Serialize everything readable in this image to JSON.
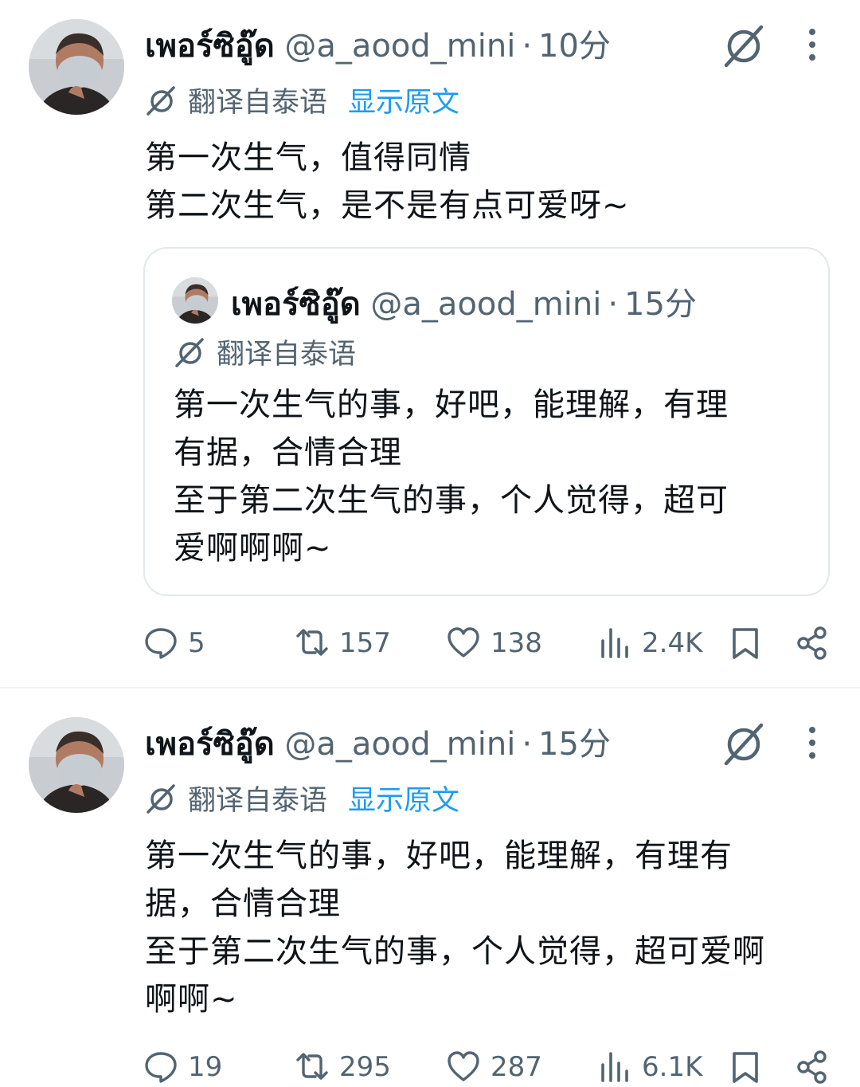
{
  "tweets": [
    {
      "display_name": "เพอร์ซิอู๊ด",
      "handle": "@a_aood_mini",
      "separator": "·",
      "time": "10分",
      "translated_label": "翻译自泰语",
      "show_original": "显示原文",
      "text": "第一次生气，值得同情\n第二次生气，是不是有点可爱呀~",
      "quote": {
        "display_name": "เพอร์ซิอู๊ด",
        "handle": "@a_aood_mini",
        "separator": "·",
        "time": "15分",
        "translated_label": "翻译自泰语",
        "text": "第一次生气的事，好吧，能理解，有理\n有据，合情合理\n至于第二次生气的事，个人觉得，超可\n爱啊啊啊~"
      },
      "actions": {
        "replies": "5",
        "reposts": "157",
        "likes": "138",
        "views": "2.4K"
      }
    },
    {
      "display_name": "เพอร์ซิอู๊ด",
      "handle": "@a_aood_mini",
      "separator": "·",
      "time": "15分",
      "translated_label": "翻译自泰语",
      "show_original": "显示原文",
      "text": "第一次生气的事，好吧，能理解，有理有\n据，合情合理\n至于第二次生气的事，个人觉得，超可爱啊\n啊啊~",
      "actions": {
        "replies": "19",
        "reposts": "295",
        "likes": "287",
        "views": "6.1K"
      }
    }
  ],
  "icons": {
    "grok": "grok-icon",
    "more": "more-icon",
    "translate": "translate-icon",
    "reply": "reply-icon",
    "repost": "repost-icon",
    "like": "like-icon",
    "views": "views-icon",
    "bookmark": "bookmark-icon",
    "share": "share-icon"
  },
  "colors": {
    "text": "#0f1419",
    "secondary": "#536471",
    "link": "#1d9bf0",
    "border": "#e3e8eb"
  }
}
